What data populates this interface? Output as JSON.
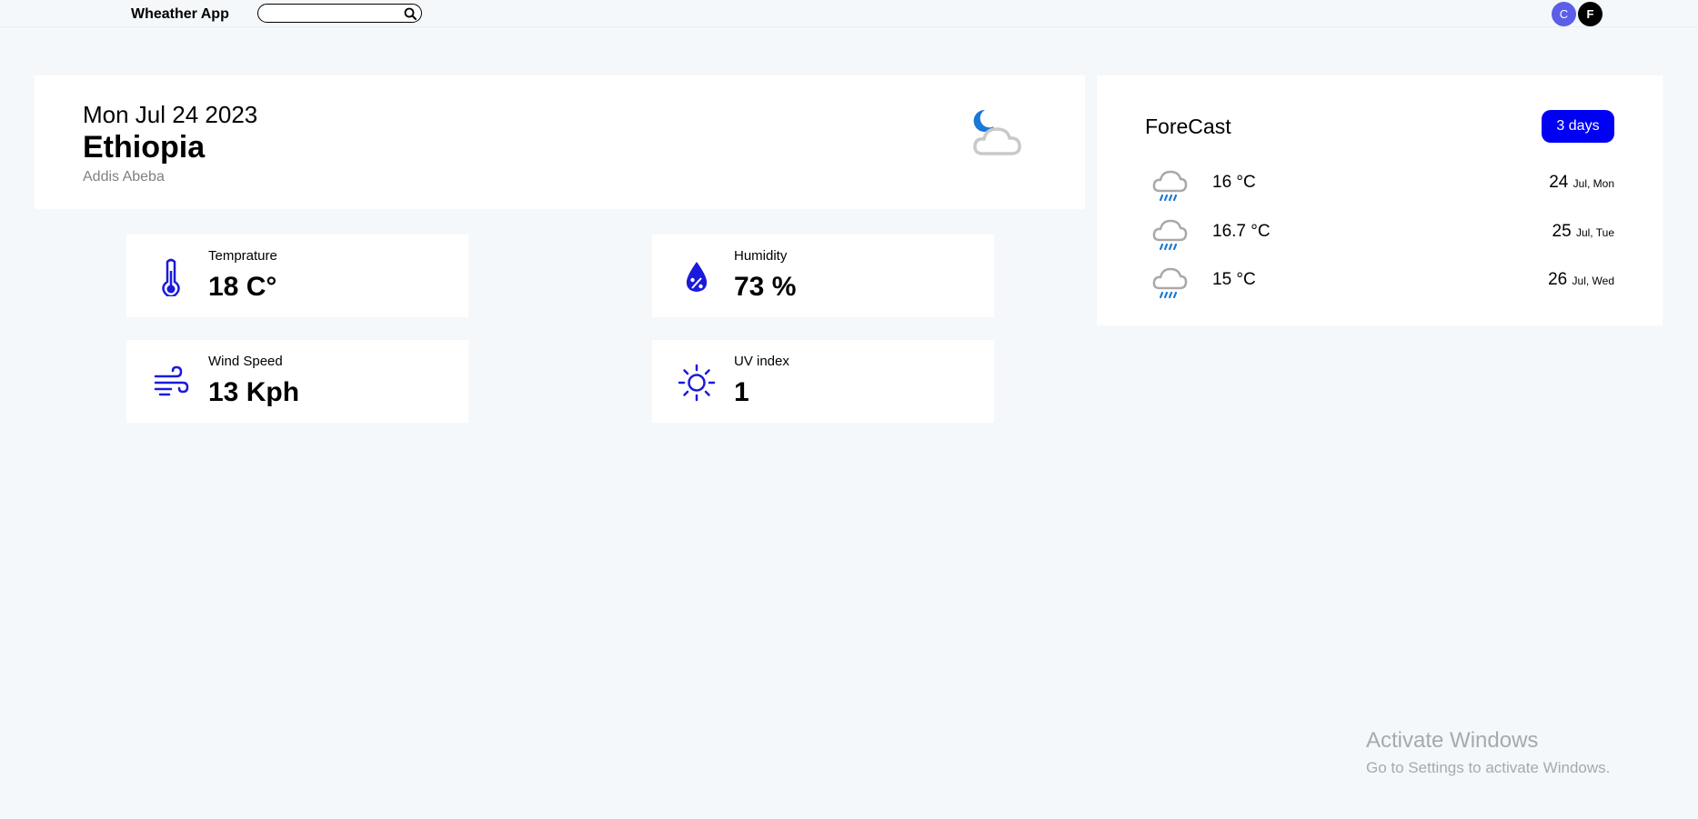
{
  "header": {
    "app_title": "Wheather App",
    "search": {
      "value": "",
      "placeholder": "",
      "icon": "search-icon"
    },
    "avatars": [
      {
        "initial": "C",
        "color": "#5b5fe8"
      },
      {
        "initial": "F",
        "color": "#000000"
      }
    ]
  },
  "current": {
    "date": "Mon Jul 24 2023",
    "country": "Ethiopia",
    "city": "Addis Abeba",
    "icon": "night-cloudy-icon"
  },
  "stats": [
    {
      "label": "Temprature",
      "value": "18 C°",
      "icon": "thermometer-icon"
    },
    {
      "label": "Humidity",
      "value": "73 %",
      "icon": "humidity-drop-icon"
    },
    {
      "label": "Wind Speed",
      "value": "13 Kph",
      "icon": "wind-icon"
    },
    {
      "label": "UV index",
      "value": "1",
      "icon": "sun-icon"
    }
  ],
  "forecast": {
    "title": "ForeCast",
    "button_label": "3 days",
    "days": [
      {
        "temp": "16 °C",
        "day": "24",
        "month_weekday": "Jul, Mon",
        "icon": "rain-cloud-icon"
      },
      {
        "temp": "16.7 °C",
        "day": "25",
        "month_weekday": "Jul, Tue",
        "icon": "rain-cloud-icon"
      },
      {
        "temp": "15 °C",
        "day": "26",
        "month_weekday": "Jul, Wed",
        "icon": "rain-cloud-icon"
      }
    ]
  },
  "watermark": {
    "title": "Activate Windows",
    "subtitle": "Go to Settings to activate Windows."
  },
  "colors": {
    "accent_blue": "#0000f5",
    "icon_blue": "#1a1adb",
    "background": "#f5f8fb"
  }
}
